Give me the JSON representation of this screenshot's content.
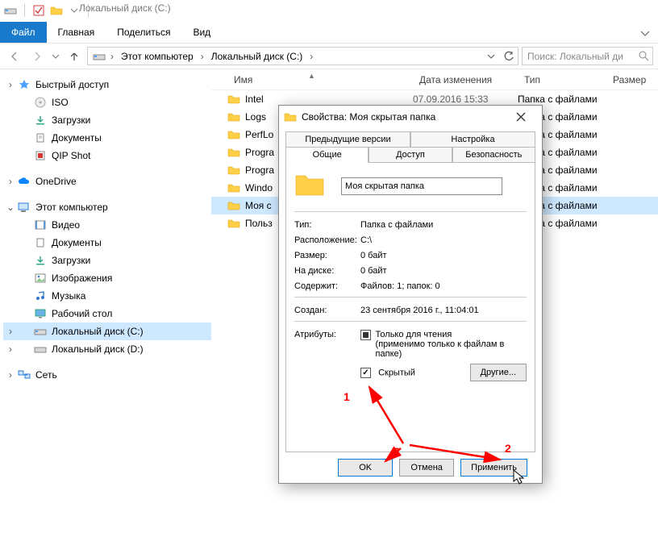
{
  "window_title": "Локальный диск (C:)",
  "ribbon": {
    "file": "Файл",
    "tabs": [
      "Главная",
      "Поделиться",
      "Вид"
    ]
  },
  "breadcrumb": {
    "root": "Этот компьютер",
    "loc": "Локальный диск (C:)"
  },
  "search_placeholder": "Поиск: Локальный ди",
  "columns": {
    "name": "Имя",
    "date": "Дата изменения",
    "type": "Тип",
    "size": "Размер"
  },
  "nav": {
    "quick": "Быстрый доступ",
    "quick_items": [
      "ISO",
      "Загрузки",
      "Документы",
      "QIP Shot"
    ],
    "onedrive": "OneDrive",
    "thispc": "Этот компьютер",
    "thispc_items": [
      "Видео",
      "Документы",
      "Загрузки",
      "Изображения",
      "Музыка",
      "Рабочий стол",
      "Локальный диск (C:)",
      "Локальный диск (D:)"
    ],
    "network": "Сеть"
  },
  "files": {
    "date0": "07.09.2016 15:33",
    "type_folder": "Папка с файлами",
    "names": [
      "Intel",
      "Logs",
      "PerfLo",
      "Progra",
      "Progra",
      "Windo",
      "Моя с",
      "Польз"
    ]
  },
  "dialog": {
    "title_prefix": "Свойства: ",
    "title_name": "Моя скрытая папка",
    "tabs": {
      "prev": "Предыдущие версии",
      "settings": "Настройка",
      "general": "Общие",
      "access": "Доступ",
      "security": "Безопасность"
    },
    "name_value": "Моя скрытая папка",
    "labels": {
      "type": "Тип:",
      "location": "Расположение:",
      "size": "Размер:",
      "ondisk": "На диске:",
      "contains": "Содержит:",
      "created": "Создан:",
      "attrs": "Атрибуты:"
    },
    "values": {
      "type": "Папка с файлами",
      "location": "C:\\",
      "size": "0 байт",
      "ondisk": "0 байт",
      "contains": "Файлов: 1; папок: 0",
      "created": "23 сентября 2016 г., 11:04:01"
    },
    "attrs": {
      "readonly": "Только для чтения",
      "readonly_sub": "(применимо только к файлам в папке)",
      "hidden": "Скрытый",
      "other": "Другие..."
    },
    "buttons": {
      "ok": "OK",
      "cancel": "Отмена",
      "apply": "Применить"
    }
  },
  "annotations": {
    "n1": "1",
    "n2": "2",
    "n3": "3"
  }
}
